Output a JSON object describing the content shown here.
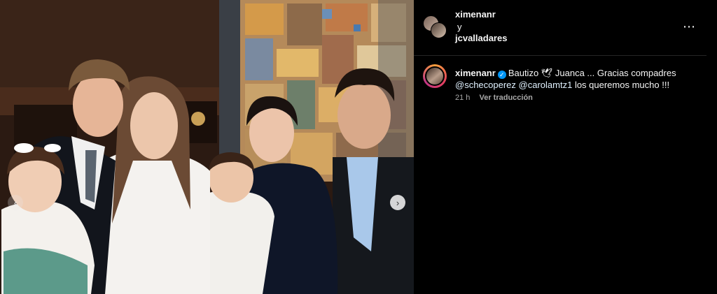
{
  "header": {
    "user1": "ximenanr",
    "separator": "y",
    "user2": "jcvalladares",
    "more_icon": "⋯"
  },
  "caption": {
    "username": "ximenanr",
    "text_part1": "Bautizo 🕊 Juanca ... Gracias compadres",
    "mention1": "@schecoperez",
    "mention2": "@carolamtz1",
    "text_part2": "los queremos mucho !!!"
  },
  "meta": {
    "time": "21 h",
    "translate": "Ver traducción"
  },
  "carousel": {
    "next_icon": "›",
    "prev_icon": "‹"
  },
  "colors": {
    "background": "#000000",
    "verified": "#0095f6",
    "secondary_text": "#a8a8a8"
  }
}
